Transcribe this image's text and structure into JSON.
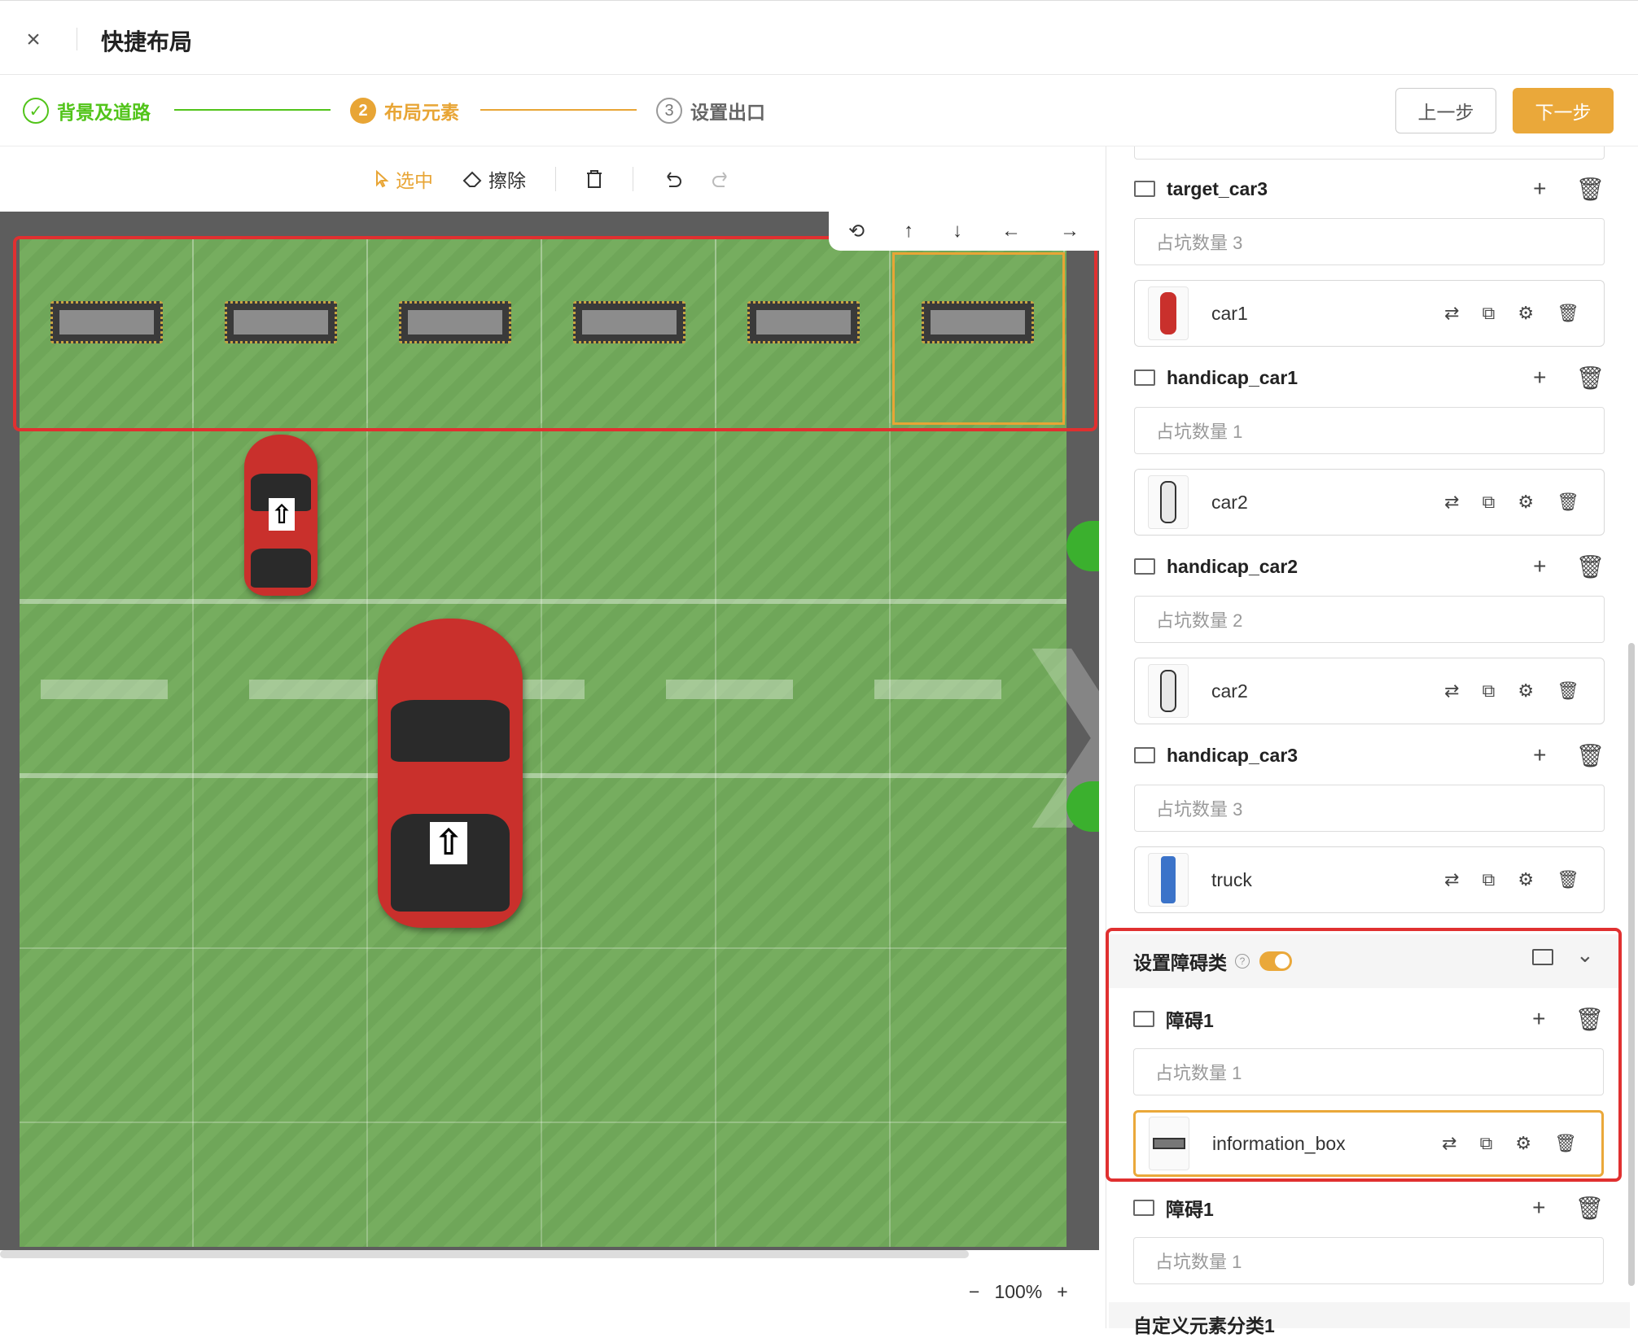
{
  "header": {
    "title": "快捷布局",
    "close_icon": "close-icon"
  },
  "steps": [
    {
      "num": "",
      "label": "背景及道路",
      "state": "done",
      "icon": "check-circle-icon"
    },
    {
      "num": "2",
      "label": "布局元素",
      "state": "active"
    },
    {
      "num": "3",
      "label": "设置出口",
      "state": "pending"
    }
  ],
  "nav": {
    "prev_label": "上一步",
    "next_label": "下一步"
  },
  "toolbar": {
    "select_label": "选中",
    "erase_label": "擦除",
    "delete_icon": "trash-icon",
    "undo_icon": "undo-icon",
    "redo_icon": "redo-icon"
  },
  "zoom": {
    "minus": "−",
    "value": "100%",
    "plus": "+"
  },
  "colors": {
    "accent": "#eaa83a",
    "success": "#52c41a",
    "highlight": "#e03030",
    "lot": "#6fa659"
  },
  "groups": [
    {
      "name": "target_car3",
      "count_label": "占坑数量 3",
      "item": "car1",
      "thumb": "red-car"
    },
    {
      "name": "handicap_car1",
      "count_label": "占坑数量 1",
      "item": "car2",
      "thumb": "white-car"
    },
    {
      "name": "handicap_car2",
      "count_label": "占坑数量 2",
      "item": "car2",
      "thumb": "white-car"
    },
    {
      "name": "handicap_car3",
      "count_label": "占坑数量 3",
      "item": "truck",
      "thumb": "blue-truck"
    }
  ],
  "obstacles": {
    "title": "设置障碍类",
    "enabled": true,
    "groups": [
      {
        "name": "障碍1",
        "count_label": "占坑数量 1",
        "item": "information_box"
      },
      {
        "name": "障碍1",
        "count_label": "占坑数量 1"
      }
    ]
  },
  "custom_section": {
    "title": "自定义元素分类1"
  }
}
